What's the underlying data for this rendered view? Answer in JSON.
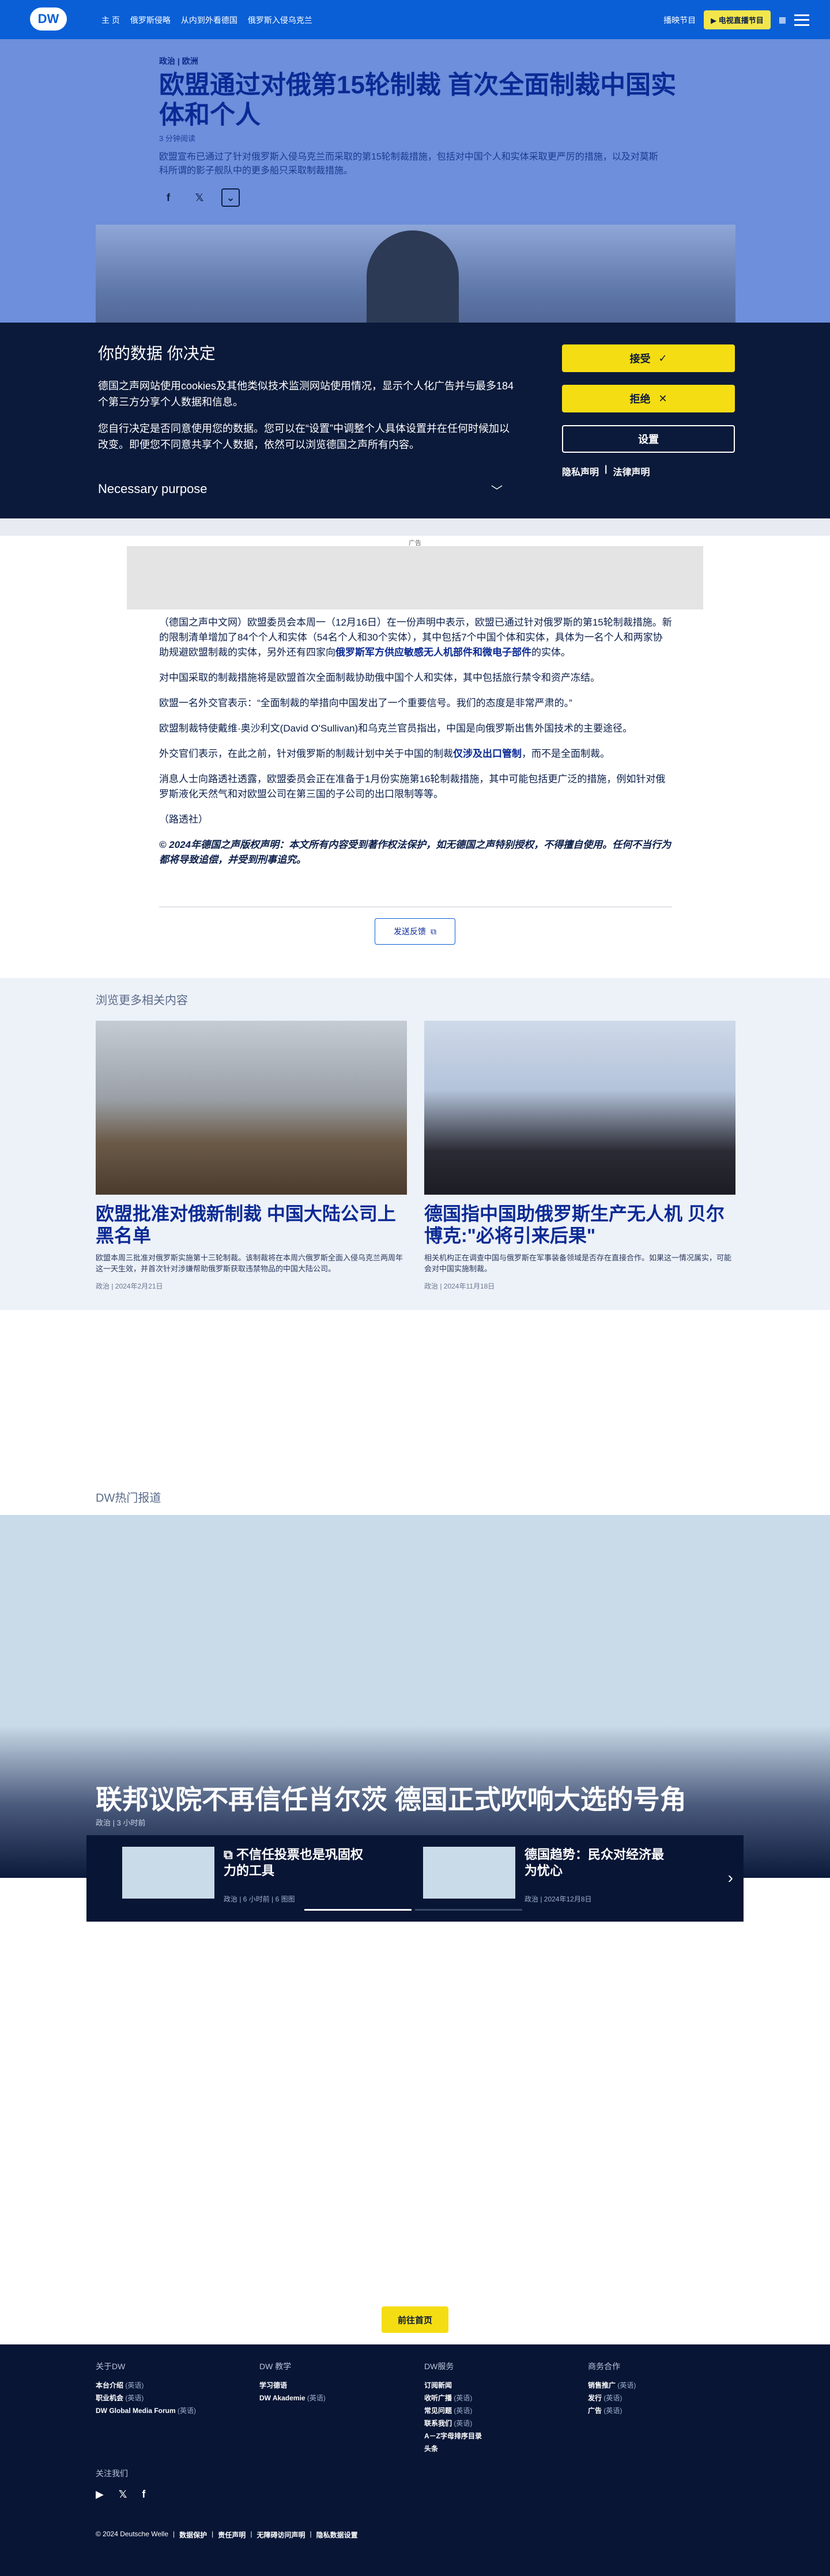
{
  "nav": {
    "logo": "DW",
    "links": [
      "主 页",
      "俄罗斯侵略",
      "从内到外看德国",
      "俄罗斯入侵乌克兰"
    ],
    "tv_link": "播映节目",
    "live_label": "▶ 电视直播节目"
  },
  "article": {
    "kicker": "政治 | 欧洲",
    "headline": "欧盟通过对俄第15轮制裁 首次全面制裁中国实体和个人",
    "dateline": "3 分钟阅读",
    "lede": "欧盟宣布已通过了针对俄罗斯入侵乌克兰而采取的第15轮制裁措施，包括对中国个人和实体采取更严厉的措施，以及对莫斯科所谓的影子舰队中的更多船只采取制裁措施。",
    "body": [
      "（德国之声中文网）欧盟委员会本周一（12月16日）在一份声明中表示，欧盟已通过针对俄罗斯的第15轮制裁措施。新的限制清单增加了84个个人和实体（54名个人和30个实体），其中包括7个中国个体和实体，具体为一名个人和两家协助规避欧盟制裁的实体，另外还有四家向",
      "对中国采取的制裁措施将是欧盟首次全面制裁协助俄中国个人和实体，其中包括旅行禁令和资产冻结。",
      "欧盟一名外交官表示：“全面制裁的举措向中国发出了一个重要信号。我们的态度是非常严肃的。”",
      "欧盟制裁特使戴维·奥沙利文(David O'Sullivan)和乌克兰官员指出，中国是向俄罗斯出售外国技术的主要途径。",
      "外交官们表示，在此之前，针对俄罗斯的制裁计划中关于中国的制裁",
      "消息人士向路透社透露，欧盟委员会正在准备于1月份实施第16轮制裁措施，其中可能包括更广泛的措施，例如针对俄罗斯液化天然气和对欧盟公司在第三国的子公司的出口限制等等。",
      "（路透社）"
    ],
    "body_link1": "俄罗斯军方供应敏感无人机部件和微电子部件",
    "body_link1_tail": "的实体。",
    "body_link2": "仅涉及出口管制",
    "body_link2_tail": "，而不是全面制裁。",
    "copyright": "© 2024年德国之声版权声明：本文所有内容受到著作权法保护，如无德国之声特别授权，不得擅自使用。任何不当行为都将导致追偿，并受到刑事追究。",
    "feedback": "发送反馈"
  },
  "ad": {
    "label": "广告"
  },
  "cookie": {
    "title": "你的数据 你决定",
    "p1": "德国之声网站使用cookies及其他类似技术监测网站使用情况，显示个人化广告并与最多184 个第三方分享个人数据和信息。",
    "p2": "您自行决定是否同意使用您的数据。您可以在“设置”中调整个人具体设置并在任何时候加以改变。即便您不同意共享个人数据，依然可以浏览德国之声所有内容。",
    "purpose": "Necessary purpose",
    "accept": "接受",
    "reject": "拒绝",
    "settings": "设置",
    "privacy": "隐私声明",
    "legal": "法律声明"
  },
  "related": {
    "title": "浏览更多相关内容",
    "cards": [
      {
        "title": "欧盟批准对俄新制裁 中国大陆公司上黑名单",
        "desc": "欧盟本周三批准对俄罗斯实施第十三轮制裁。该制裁将在本周六俄罗斯全面入侵乌克兰两周年这一天生效，并首次针对涉嫌帮助俄罗斯获取违禁物品的中国大陆公司。",
        "meta": "政治 | 2024年2月21日"
      },
      {
        "title": "德国指中国助俄罗斯生产无人机 贝尔博克:\"必将引来后果\"",
        "desc": "相关机构正在调查中国与俄罗斯在军事装备领域是否存在直接合作。如果这一情况属实，可能会对中国实施制裁。",
        "meta": "政治 | 2024年11月18日"
      }
    ]
  },
  "hot": {
    "title": "DW热门报道",
    "headline": "联邦议院不再信任肖尔茨 德国正式吹响大选的号角",
    "meta": "政治 | 3 小时前",
    "items": [
      {
        "title": "不信任投票也是巩固权力的工具",
        "meta": "政治 | 6 小时前 | 6 图图"
      },
      {
        "title": "德国趋势：民众对经济最为忧心",
        "meta": "政治 | 2024年12月8日"
      }
    ]
  },
  "home_button": "前往首页",
  "footer": {
    "columns": [
      {
        "title": "关于DW",
        "items": [
          {
            "label": "本台介绍",
            "sub": "(英语)"
          },
          {
            "label": "职业机会",
            "sub": "(英语)"
          },
          {
            "label": "DW Global Media Forum",
            "sub": "(英语)"
          }
        ]
      },
      {
        "title": "DW 教学",
        "items": [
          {
            "label": "学习德语",
            "sub": ""
          },
          {
            "label": "DW Akademie",
            "sub": "(英语)"
          }
        ]
      },
      {
        "title": "DW服务",
        "items": [
          {
            "label": "订阅新闻",
            "sub": ""
          },
          {
            "label": "收听广播",
            "sub": "(英语)"
          },
          {
            "label": "常见问题",
            "sub": "(英语)"
          },
          {
            "label": "联系我们",
            "sub": "(英语)"
          },
          {
            "label": "A－Z字母排序目录",
            "sub": ""
          },
          {
            "label": "头条",
            "sub": ""
          }
        ]
      },
      {
        "title": "商务合作",
        "items": [
          {
            "label": "销售推广",
            "sub": "(英语)"
          },
          {
            "label": "发行",
            "sub": "(英语)"
          },
          {
            "label": "广告",
            "sub": "(英语)"
          }
        ]
      }
    ],
    "follow": "关注我们",
    "legal": [
      "© 2024 Deutsche Welle",
      "数据保护",
      "责任声明",
      "无障碍访问声明",
      "隐私数据设置"
    ]
  },
  "colors": {
    "brand": "#0a5fd6",
    "accent_yellow": "#f5dd13",
    "footer_bg": "#081535"
  }
}
